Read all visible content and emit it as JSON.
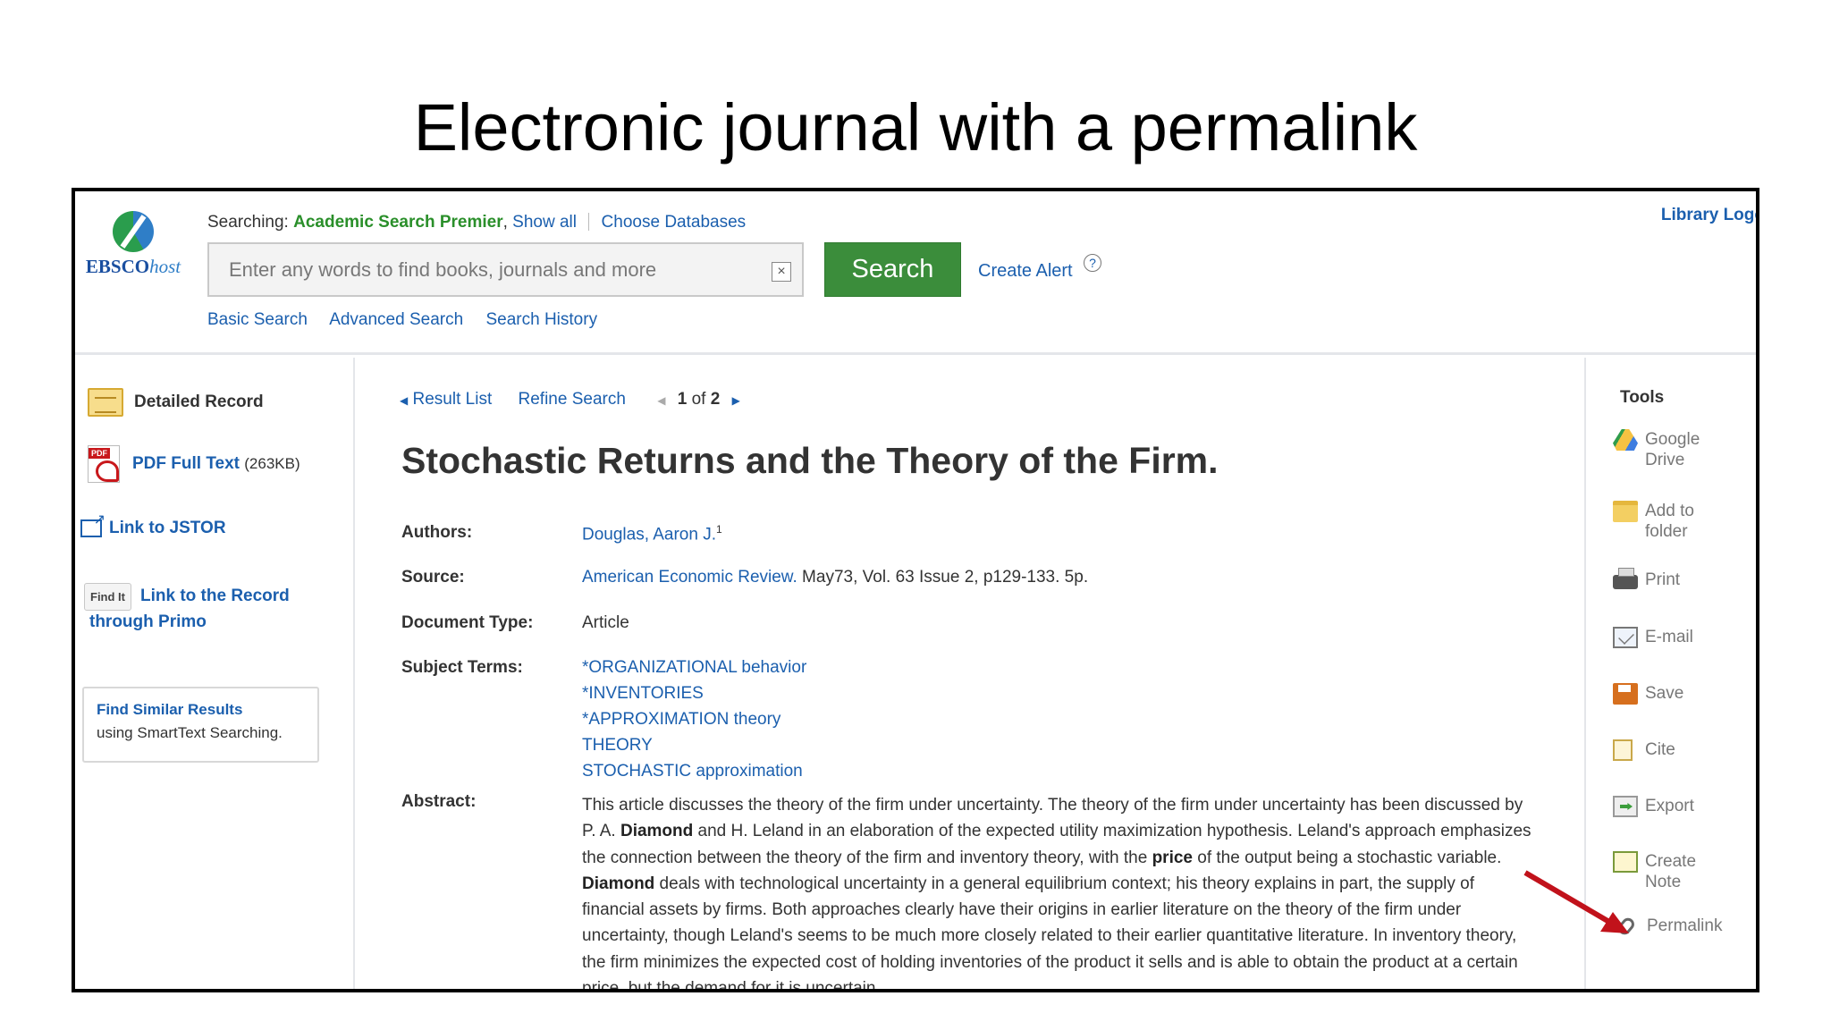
{
  "slide": {
    "title": "Electronic journal with a permalink"
  },
  "header": {
    "logo_text_bold": "EBSCO",
    "logo_text_italic": "host",
    "searching_label": "Searching:",
    "database": "Academic Search Premier",
    "show_all": "Show all",
    "choose_databases": "Choose Databases",
    "search_placeholder": "Enter any words to find books, journals and more",
    "search_button": "Search",
    "create_alert": "Create Alert",
    "help_glyph": "?",
    "library_logo": "Library Logo",
    "links": [
      "Basic Search",
      "Advanced Search",
      "Search History"
    ]
  },
  "left": {
    "detailed_record": "Detailed Record",
    "pdf_label": "PDF Full Text",
    "pdf_size": "(263KB)",
    "jstor": "Link to JSTOR",
    "findit_badge": "Find It",
    "primo_line1": "Link to the Record",
    "primo_line2": "through Primo",
    "similar_title": "Find Similar Results",
    "similar_sub": "using SmartText Searching."
  },
  "nav": {
    "result_list": "Result List",
    "refine_search": "Refine Search",
    "page_current": "1",
    "page_of": "of",
    "page_total": "2"
  },
  "record": {
    "title": "Stochastic Returns and the Theory of the Firm.",
    "labels": {
      "authors": "Authors:",
      "source": "Source:",
      "doc_type": "Document Type:",
      "subjects": "Subject Terms:",
      "abstract": "Abstract:"
    },
    "author": "Douglas, Aaron J.",
    "author_sup": "1",
    "source_journal": "American Economic Review.",
    "source_detail": "May73, Vol. 63 Issue 2, p129-133. 5p.",
    "doc_type": "Article",
    "subjects": [
      "*ORGANIZATIONAL behavior",
      "*INVENTORIES",
      "*APPROXIMATION theory",
      "THEORY",
      "STOCHASTIC approximation"
    ],
    "abstract": {
      "p1": "This article discusses the theory of the firm under uncertainty. The theory of the firm under uncertainty has been discussed by P. A. ",
      "b1": "Diamond",
      "p2": " and H. Leland in an elaboration of the expected utility maximization hypothesis. Leland's approach emphasizes the connection between the theory of the firm and inventory theory, with the ",
      "b2": "price",
      "p3": " of the output being a stochastic variable. ",
      "b3": "Diamond",
      "p4": " deals with technological uncertainty in a general equilibrium context; his theory explains in part, the supply of financial assets by firms. Both approaches clearly have their origins in earlier literature on the theory of the firm under uncertainty, though Leland's seems to be much more closely related to their earlier quantitative literature. In inventory theory, the firm minimizes the expected cost of holding inventories of the product it sells and is able to obtain the product at a certain price, but the demand for it is uncertain."
    }
  },
  "tools": {
    "title": "Tools",
    "items": [
      {
        "line1": "Google",
        "line2": "Drive",
        "icon": "google-drive-icon"
      },
      {
        "line1": "Add to",
        "line2": "folder",
        "icon": "folder-icon"
      },
      {
        "line1": "Print",
        "line2": "",
        "icon": "printer-icon"
      },
      {
        "line1": "E-mail",
        "line2": "",
        "icon": "email-icon"
      },
      {
        "line1": "Save",
        "line2": "",
        "icon": "save-icon"
      },
      {
        "line1": "Cite",
        "line2": "",
        "icon": "cite-icon"
      },
      {
        "line1": "Export",
        "line2": "",
        "icon": "export-icon"
      },
      {
        "line1": "Create",
        "line2": "Note",
        "icon": "note-icon"
      },
      {
        "line1": "Permalink",
        "line2": "",
        "icon": "link-icon"
      }
    ]
  },
  "colors": {
    "link": "#1b5fae",
    "search_button": "#3b8d3b",
    "database": "#2a8f2a",
    "arrow": "#c1121b"
  }
}
